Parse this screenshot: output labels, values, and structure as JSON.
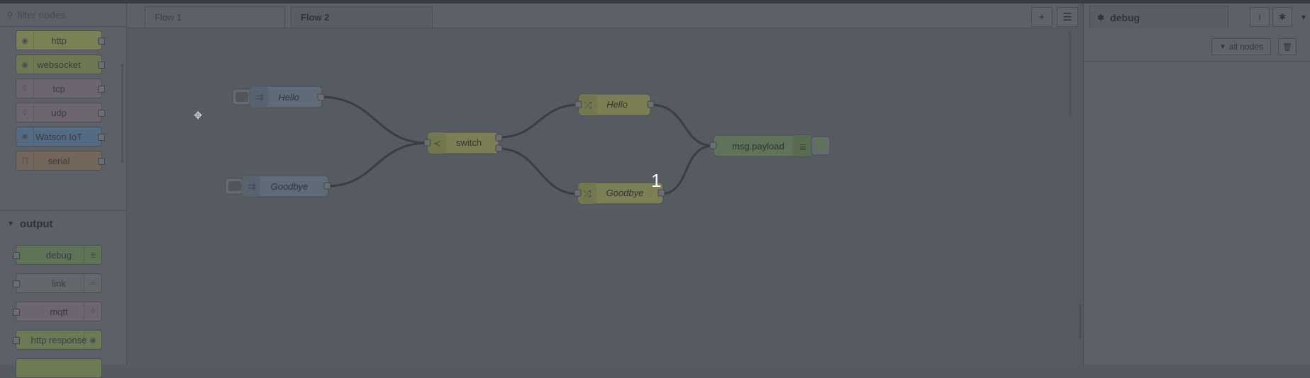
{
  "palette": {
    "filter_placeholder": "filter nodes",
    "search_icon": "search-icon",
    "input_nodes": [
      {
        "label": "http",
        "color": "#7b8055"
      },
      {
        "label": "websocket",
        "color": "#6f7753"
      },
      {
        "label": "tcp",
        "color": "#6d6572"
      },
      {
        "label": "udp",
        "color": "#6d6572"
      },
      {
        "label": "Watson IoT",
        "color": "#536c84"
      },
      {
        "label": "serial",
        "color": "#73675c"
      }
    ],
    "category_output": "output",
    "output_nodes": [
      {
        "label": "debug",
        "color": "#5e7357"
      },
      {
        "label": "link",
        "color": "#63676b"
      },
      {
        "label": "mqtt",
        "color": "#6d6572"
      },
      {
        "label": "http response",
        "color": "#6c7a55"
      }
    ]
  },
  "tabs": [
    {
      "label": "Flow 1",
      "active": false
    },
    {
      "label": "Flow 2",
      "active": true
    }
  ],
  "tab_buttons": {
    "add": "+",
    "list": "☰"
  },
  "flow": {
    "nodes": [
      {
        "label": "Hello",
        "type": "inject",
        "italic": true
      },
      {
        "label": "Goodbye",
        "type": "inject",
        "italic": true
      },
      {
        "label": "switch",
        "type": "switch",
        "italic": false
      },
      {
        "label": "Hello",
        "type": "change",
        "italic": true
      },
      {
        "label": "Goodbye",
        "type": "change",
        "italic": true
      },
      {
        "label": "msg.payload",
        "type": "debug",
        "italic": false
      }
    ],
    "badge": "1"
  },
  "sidebar": {
    "tab_label": "debug",
    "all_nodes_label": "all nodes",
    "info_icon": "i",
    "chevron": "▾"
  },
  "colors": {
    "inject": "#5f6b79",
    "switch": "#7b7f53",
    "change": "#7b7f53",
    "debug": "#5e7357",
    "wire": "#3a3d41"
  }
}
